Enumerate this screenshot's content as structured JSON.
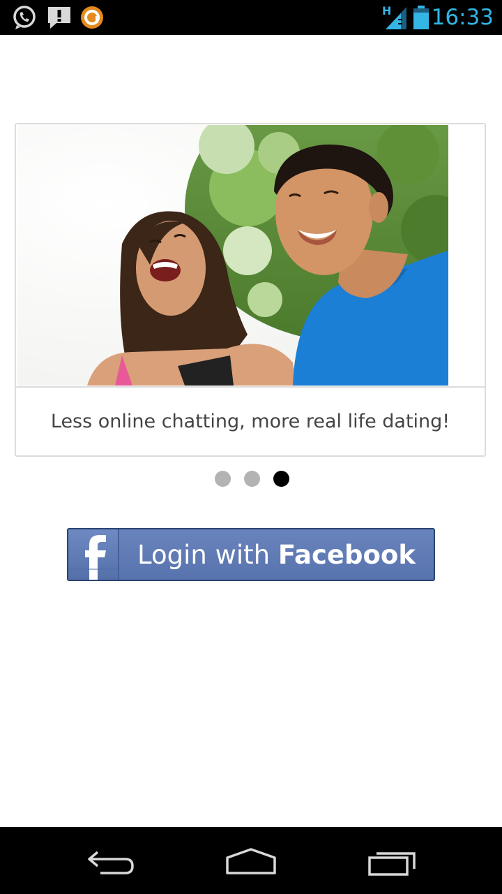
{
  "status_bar": {
    "time": "16:33",
    "network_type": "H",
    "icons": [
      "whatsapp-icon",
      "notification-alert-icon",
      "app-notification-icon",
      "signal-icon",
      "battery-icon"
    ],
    "accent_color": "#33b5e5"
  },
  "carousel": {
    "caption": "Less online chatting, more real life dating!",
    "page_count": 3,
    "active_page": 3,
    "dot_active_color": "#000000",
    "dot_inactive_color": "#b3b3b3"
  },
  "login": {
    "label_prefix": "Login with ",
    "label_brand": "Facebook",
    "brand_color": "#5b74ab"
  },
  "nav_bar": {
    "buttons": [
      "back-icon",
      "home-icon",
      "recent-apps-icon"
    ]
  }
}
